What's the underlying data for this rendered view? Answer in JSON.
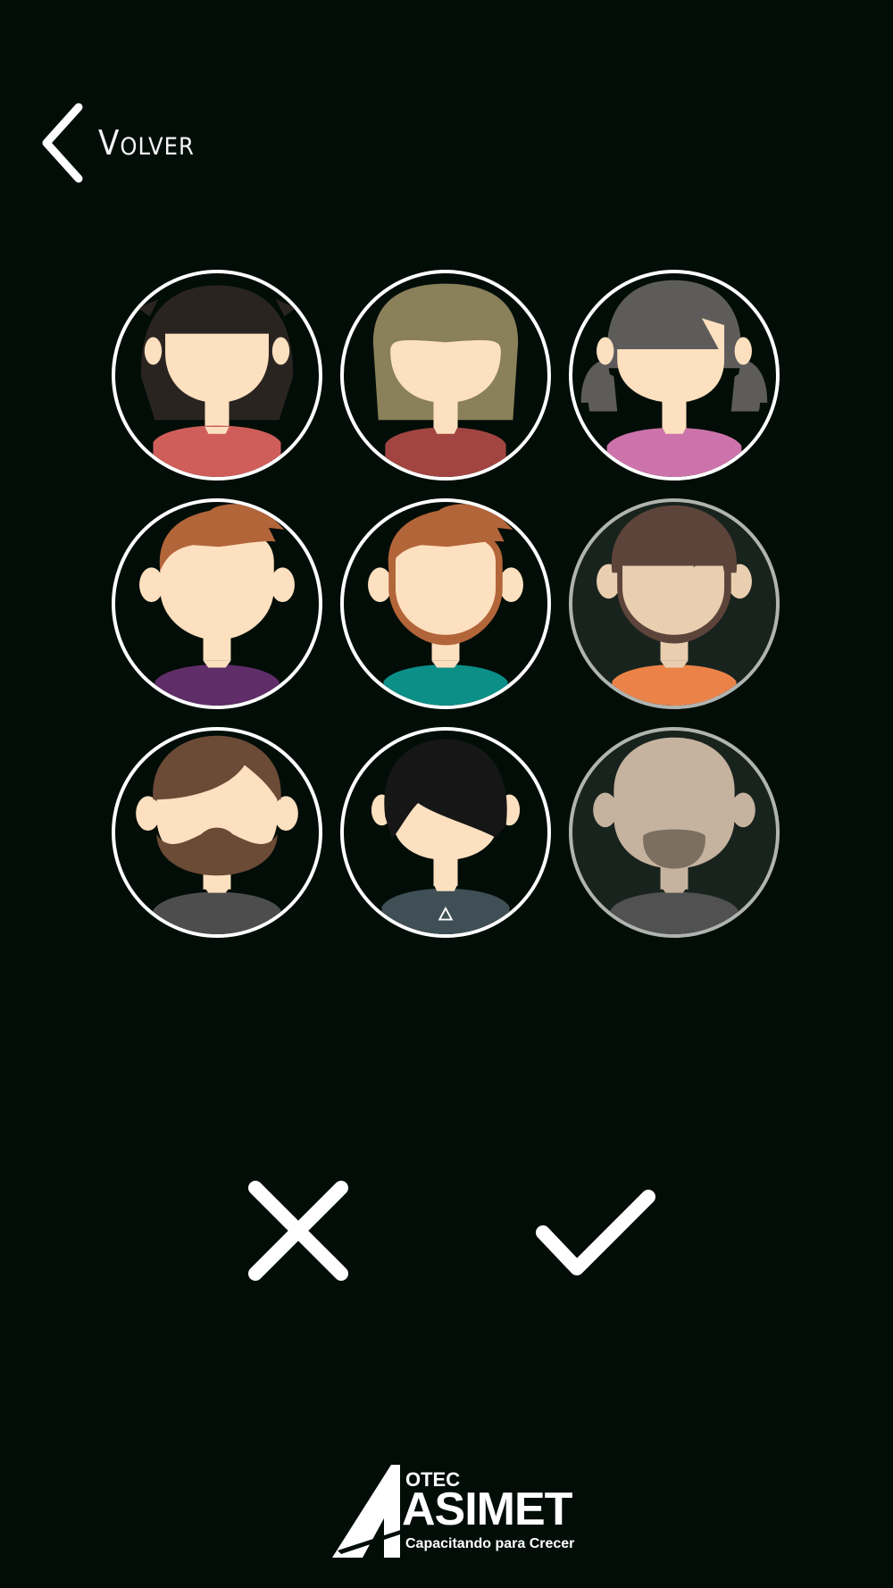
{
  "nav": {
    "back_label": "Volver",
    "back_icon": "chevron-left-icon"
  },
  "avatars": [
    {
      "id": "woman-black-hair",
      "skin": "#fde0bf",
      "hair": "#2a2420",
      "shirt": "#cf5e5b",
      "selected": false
    },
    {
      "id": "woman-olive-hair",
      "skin": "#fde0bf",
      "hair": "#8a8059",
      "shirt": "#a24541",
      "selected": false
    },
    {
      "id": "girl-pigtails",
      "skin": "#fde0bf",
      "hair": "#5e5c5b",
      "shirt": "#cd73ab",
      "selected": false
    },
    {
      "id": "man-ginger-spiky",
      "skin": "#fde0bf",
      "hair": "#b3653a",
      "shirt": "#5f2d68",
      "selected": false
    },
    {
      "id": "man-ginger-beard",
      "skin": "#fde0bf",
      "hair": "#b3653a",
      "shirt": "#0b8f87",
      "selected": false
    },
    {
      "id": "man-brown-hair",
      "skin": "#fde0bf",
      "hair": "#654a42",
      "shirt": "#ff8e4f",
      "selected": false,
      "dimmed": true
    },
    {
      "id": "man-bearded",
      "skin": "#fde0bf",
      "hair": "#6b4a36",
      "shirt": "#4d4d4d",
      "selected": false
    },
    {
      "id": "boy-emo-hair",
      "skin": "#fde0bf",
      "hair": "#161616",
      "shirt": "#3f4f55",
      "selected": true
    },
    {
      "id": "man-bald",
      "skin": "#d7c2ac",
      "hair": "#87786a",
      "shirt": "#575757",
      "selected": false,
      "dimmed": true
    }
  ],
  "actions": {
    "cancel_icon": "close-icon",
    "confirm_icon": "checkmark-icon"
  },
  "logo": {
    "small": "OTEC",
    "brand": "ASIMET",
    "slogan": "Capacitando para Crecer"
  },
  "colors": {
    "background": "#020d08",
    "foreground": "#ffffff"
  }
}
